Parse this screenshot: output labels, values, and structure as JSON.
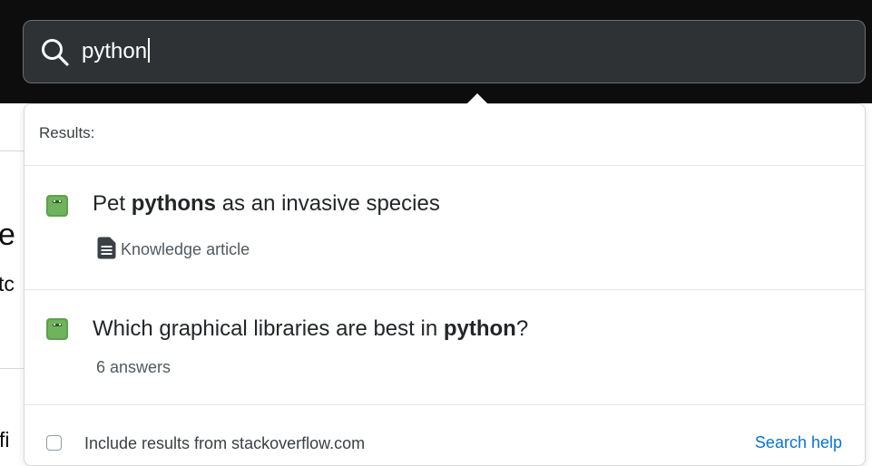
{
  "search": {
    "query": "python"
  },
  "background_page": {
    "fragments": [
      "e",
      "tc",
      "fi"
    ]
  },
  "dropdown": {
    "header": "Results:",
    "results": [
      {
        "title_prefix": "Pet ",
        "title_match": "pythons",
        "title_suffix": " as an invasive species",
        "meta": "Knowledge article",
        "meta_icon": "document-icon",
        "site_icon": "site-logo-icon"
      },
      {
        "title_prefix": "Which graphical libraries are best in ",
        "title_match": "python",
        "title_suffix": "?",
        "meta": "6 answers",
        "site_icon": "site-logo-icon"
      }
    ],
    "footer": {
      "checkbox_label": "Include results from stackoverflow.com",
      "checkbox_checked": false,
      "help_link": "Search help"
    }
  },
  "colors": {
    "topbar_bg": "#0d0d0e",
    "search_bg": "#2f3235",
    "site_icon_green": "#5fa04e",
    "link_blue": "#0a74d0"
  }
}
